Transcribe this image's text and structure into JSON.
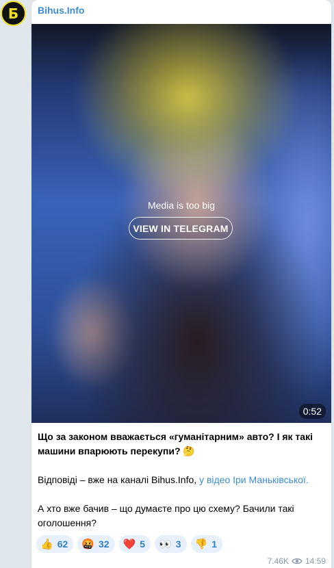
{
  "channel": {
    "name": "Bihus.Info",
    "avatar_glyph": "Б",
    "avatar_colors": {
      "background": "#111111",
      "accent": "#f2e024"
    }
  },
  "media": {
    "message": "Media is too big",
    "button_label": "VIEW IN TELEGRAM",
    "duration": "0:52"
  },
  "post": {
    "paragraph1": "Що за законом вважається «гуманітарним» авто? І як такі машини впарюють перекупи? 🤔",
    "paragraph2_text": "Відповіді – вже на каналі Bihus.Info, ",
    "paragraph2_link": "у відео Іри Маньківської.",
    "paragraph3": "А хто вже бачив – що думаєте про цю схему? Бачили такі оголошення?"
  },
  "reactions": [
    {
      "emoji": "👍",
      "icon": "thumbs-up-icon",
      "count": "62"
    },
    {
      "emoji": "🤬",
      "icon": "angry-face-icon",
      "count": "32"
    },
    {
      "emoji": "❤️",
      "icon": "heart-icon",
      "count": "5"
    },
    {
      "emoji": "👀",
      "icon": "eyes-icon",
      "count": "3"
    },
    {
      "emoji": "👎",
      "icon": "thumbs-down-icon",
      "count": "1"
    }
  ],
  "meta": {
    "views": "7.46K",
    "time": "14:59"
  },
  "colors": {
    "link": "#3a8bd3",
    "reaction_bg": "#e8f1fb",
    "reaction_text": "#2f7ec2",
    "page_bg": "#dfe7ec"
  }
}
